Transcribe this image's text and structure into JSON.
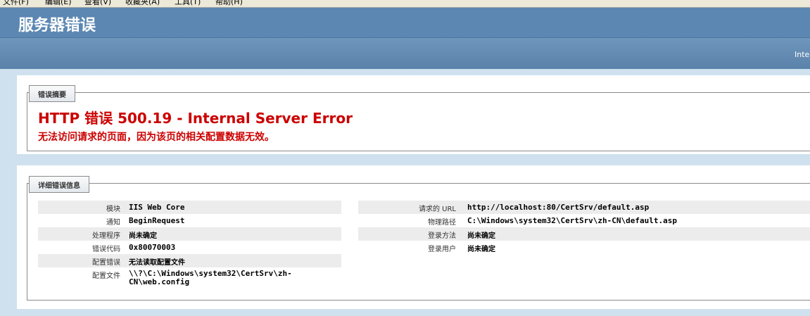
{
  "menu": [
    {
      "label": "文件(F)"
    },
    {
      "label": "编辑(E)"
    },
    {
      "label": "查看(V)"
    },
    {
      "label": "收藏夹(A)"
    },
    {
      "label": "工具(T)"
    },
    {
      "label": "帮助(H)"
    }
  ],
  "header": {
    "title": "服务器错误",
    "right_text": "Inte"
  },
  "summary": {
    "legend": "错误摘要",
    "error_title": "HTTP 错误 500.19 - Internal Server Error",
    "error_message": "无法访问请求的页面，因为该页的相关配置数据无效。"
  },
  "details": {
    "legend": "详细错误信息",
    "left": [
      {
        "label": "模块",
        "value": "IIS Web Core"
      },
      {
        "label": "通知",
        "value": "BeginRequest"
      },
      {
        "label": "处理程序",
        "value": "尚未确定"
      },
      {
        "label": "错误代码",
        "value": "0x80070003"
      },
      {
        "label": "配置错误",
        "value": "无法读取配置文件"
      },
      {
        "label": "配置文件",
        "value": "\\\\?\\C:\\Windows\\system32\\CertSrv\\zh-CN\\web.config"
      }
    ],
    "right": [
      {
        "label": "请求的 URL",
        "value": "http://localhost:80/CertSrv/default.asp"
      },
      {
        "label": "物理路径",
        "value": "C:\\Windows\\system32\\CertSrv\\zh-CN\\default.asp"
      },
      {
        "label": "登录方法",
        "value": "尚未确定"
      },
      {
        "label": "登录用户",
        "value": "尚未确定"
      }
    ]
  },
  "colors": {
    "header": "#5c87b2",
    "error_red": "#cc0000",
    "page_bg": "#cfe1ee"
  }
}
